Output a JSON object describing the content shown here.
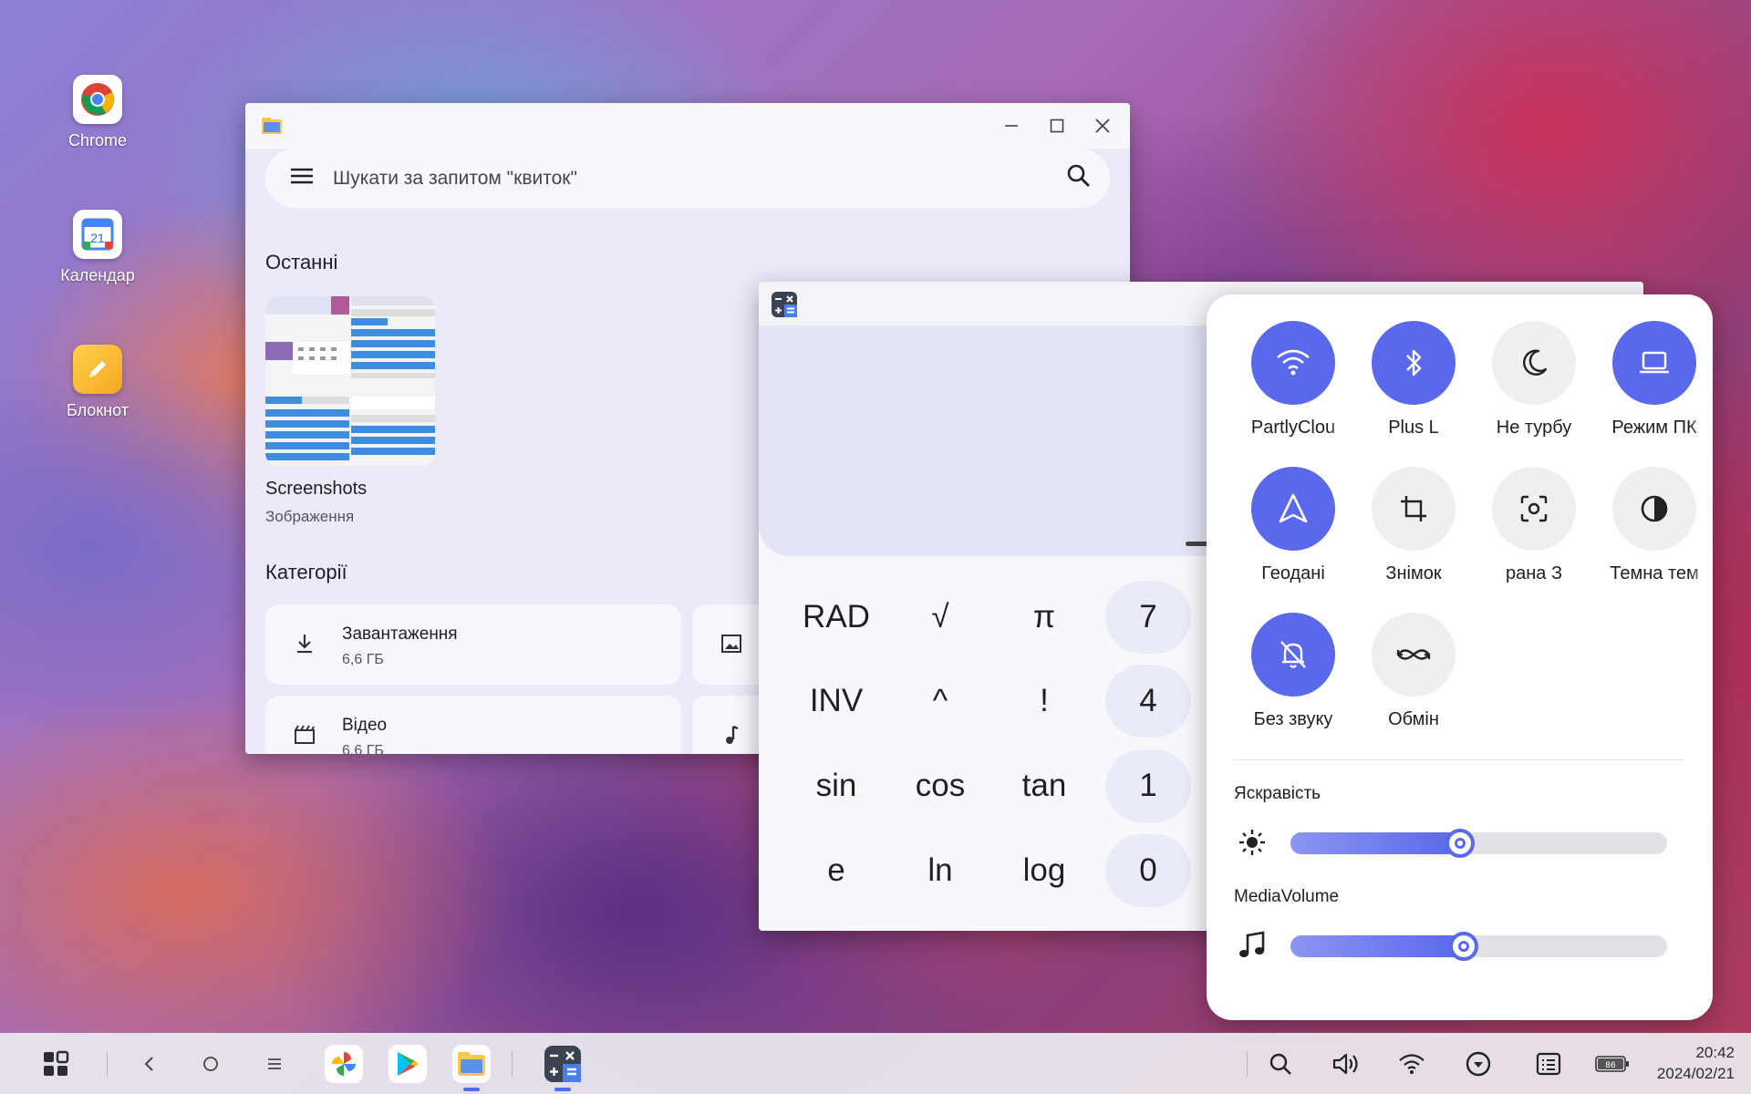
{
  "desktop": {
    "icons": [
      {
        "label": "Chrome",
        "icon": "chrome-icon"
      },
      {
        "label": "Календар",
        "icon": "calendar-icon",
        "badge": "21"
      },
      {
        "label": "Блокнот",
        "icon": "notepad-icon"
      }
    ]
  },
  "files": {
    "search_placeholder": "Шукати за запитом \"квиток\"",
    "recent_title": "Останні",
    "recent_item": {
      "name": "Screenshots",
      "type": "Зображення"
    },
    "categories_title": "Категорії",
    "categories": [
      {
        "name": "Завантаження",
        "size": "6,6 ГБ",
        "icon": "download-icon"
      },
      {
        "name": "Відео",
        "size": "6,6 ГБ",
        "icon": "video-icon"
      }
    ]
  },
  "calculator": {
    "keys": [
      [
        "RAD",
        "√",
        "π",
        "7"
      ],
      [
        "INV",
        "^",
        "!",
        "4"
      ],
      [
        "sin",
        "cos",
        "tan",
        "1"
      ],
      [
        "e",
        "ln",
        "log",
        "0"
      ]
    ]
  },
  "quick_settings": {
    "tiles": [
      {
        "label": "PartlyClou",
        "icon": "wifi-icon",
        "on": true
      },
      {
        "label": "Plus     L",
        "icon": "bluetooth-icon",
        "on": true
      },
      {
        "label": "Не турбу",
        "icon": "moon-icon",
        "on": false
      },
      {
        "label": "Режим ПК",
        "icon": "laptop-icon",
        "on": true
      },
      {
        "label": "Геодані",
        "icon": "location-icon",
        "on": true
      },
      {
        "label": "Знімок",
        "icon": "crop-icon",
        "on": false
      },
      {
        "label": "рана     З",
        "icon": "screen-record-icon",
        "on": false
      },
      {
        "label": "Темна тем",
        "icon": "contrast-icon",
        "on": false
      },
      {
        "label": "Без звуку",
        "icon": "bell-off-icon",
        "on": true
      },
      {
        "label": "Обмін",
        "icon": "share-icon",
        "on": false
      }
    ],
    "brightness_label": "Яскравість",
    "brightness_level": 0.45,
    "volume_label": "MediaVolume",
    "volume_level": 0.46
  },
  "taskbar": {
    "time": "20:42",
    "date": "2024/02/21",
    "battery": "86"
  },
  "colors": {
    "accent": "#5a68eb"
  }
}
